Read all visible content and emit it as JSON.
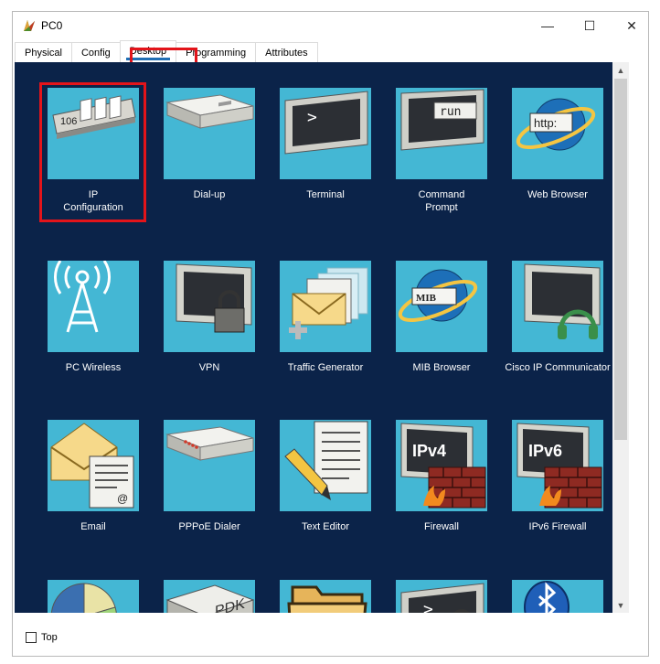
{
  "window": {
    "title": "PC0",
    "minimize": "—",
    "maximize": "☐",
    "close": "✕"
  },
  "tabs": [
    {
      "label": "Physical"
    },
    {
      "label": "Config"
    },
    {
      "label": "Desktop",
      "active": true
    },
    {
      "label": "Programming"
    },
    {
      "label": "Attributes"
    }
  ],
  "desktop": {
    "apps": [
      {
        "label": "IP\nConfiguration",
        "icon": "ip-configuration-icon",
        "screen_text": "106"
      },
      {
        "label": "Dial-up",
        "icon": "dialup-modem-icon"
      },
      {
        "label": "Terminal",
        "icon": "terminal-monitor-icon",
        "screen_text": ">"
      },
      {
        "label": "Command\nPrompt",
        "icon": "command-prompt-icon",
        "screen_text": "run"
      },
      {
        "label": "Web Browser",
        "icon": "web-browser-icon",
        "screen_text": "http:"
      },
      {
        "label": "PC Wireless",
        "icon": "wireless-tower-icon"
      },
      {
        "label": "VPN",
        "icon": "vpn-lock-monitor-icon"
      },
      {
        "label": "Traffic Generator",
        "icon": "traffic-generator-envelopes-icon"
      },
      {
        "label": "MIB Browser",
        "icon": "mib-browser-icon",
        "screen_text": "MIB"
      },
      {
        "label": "Cisco IP Communicator",
        "icon": "ip-communicator-headset-icon"
      },
      {
        "label": "Email",
        "icon": "email-envelope-icon",
        "screen_text": "@"
      },
      {
        "label": "PPPoE Dialer",
        "icon": "pppoe-dialer-icon"
      },
      {
        "label": "Text Editor",
        "icon": "text-editor-pencil-icon"
      },
      {
        "label": "Firewall",
        "icon": "firewall-ipv4-icon",
        "screen_text": "IPv4"
      },
      {
        "label": "IPv6 Firewall",
        "icon": "firewall-ipv6-icon",
        "screen_text": "IPv6"
      },
      {
        "label": "",
        "icon": "pie-chart-icon"
      },
      {
        "label": "",
        "icon": "box-icon",
        "screen_text": "PDK"
      },
      {
        "label": "",
        "icon": "folder-icon"
      },
      {
        "label": "",
        "icon": "terminal-lock-icon",
        "screen_text": ">"
      },
      {
        "label": "",
        "icon": "bluetooth-icon"
      }
    ]
  },
  "footer": {
    "top_label": "Top",
    "top_checked": false
  },
  "colors": {
    "desktop_bg": "#0b2349",
    "tile_bg": "#44b7d4",
    "highlight": "#e3141a",
    "active_tab_underline": "#1f6fb5"
  }
}
